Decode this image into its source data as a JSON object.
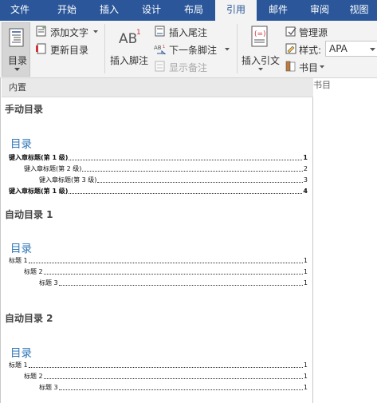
{
  "tabs": [
    {
      "label": "文件",
      "active": false
    },
    {
      "label": "开始",
      "active": false
    },
    {
      "label": "插入",
      "active": false
    },
    {
      "label": "设计",
      "active": false
    },
    {
      "label": "布局",
      "active": false
    },
    {
      "label": "引用",
      "active": true
    },
    {
      "label": "邮件",
      "active": false
    },
    {
      "label": "审阅",
      "active": false
    },
    {
      "label": "视图",
      "active": false
    }
  ],
  "ribbon": {
    "toc_button": "目录",
    "add_text": "添加文字",
    "update_toc": "更新目录",
    "insert_footnote": "插入脚注",
    "insert_endnote": "插入尾注",
    "next_footnote": "下一条脚注",
    "show_notes": "显示备注",
    "insert_citation": "插入引文",
    "manage_sources": "管理源",
    "style_label": "样式:",
    "style_value": "APA",
    "bibliography": "书目",
    "group_label_partial": "书目"
  },
  "panel": {
    "header": "内置",
    "sections": [
      {
        "name": "手动目录",
        "toc_title": "目录",
        "entries": [
          {
            "text": "键入章标题(第 1 级)",
            "page": "1",
            "level": 1,
            "bold": true
          },
          {
            "text": "键入章标题(第 2 级)",
            "page": "2",
            "level": 2,
            "bold": false
          },
          {
            "text": "键入章标题(第 3 级)",
            "page": "3",
            "level": 3,
            "bold": false
          },
          {
            "text": "键入章标题(第 1 级)",
            "page": "4",
            "level": 1,
            "bold": true
          }
        ]
      },
      {
        "name": "自动目录 1",
        "toc_title": "目录",
        "entries": [
          {
            "text": "标题 1",
            "page": "1",
            "level": 1,
            "bold": false
          },
          {
            "text": "标题 2",
            "page": "1",
            "level": 2,
            "bold": false
          },
          {
            "text": "标题 3",
            "page": "1",
            "level": 3,
            "bold": false
          }
        ]
      },
      {
        "name": "自动目录 2",
        "toc_title": "目录",
        "entries": [
          {
            "text": "标题 1",
            "page": "1",
            "level": 1,
            "bold": false
          },
          {
            "text": "标题 2",
            "page": "1",
            "level": 2,
            "bold": false
          },
          {
            "text": "标题 3",
            "page": "1",
            "level": 3,
            "bold": false
          }
        ]
      }
    ]
  }
}
